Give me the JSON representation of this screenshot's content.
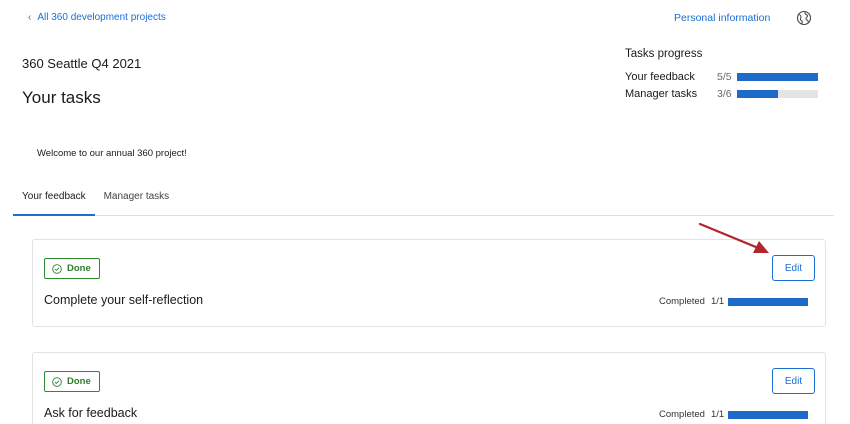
{
  "header": {
    "back_link": "All 360 development projects",
    "personal_link": "Personal information",
    "globe_icon": "globe-icon"
  },
  "project": {
    "name": "360 Seattle Q4 2021",
    "page_title": "Your tasks"
  },
  "progress": {
    "title": "Tasks progress",
    "rows": [
      {
        "label": "Your feedback",
        "count": "5/5",
        "fraction": 1.0
      },
      {
        "label": "Manager tasks",
        "count": "3/6",
        "fraction": 0.5
      }
    ]
  },
  "welcome": "Welcome to our annual 360 project!",
  "tabs": [
    {
      "label": "Your feedback",
      "active": true
    },
    {
      "label": "Manager tasks",
      "active": false
    }
  ],
  "tasks": [
    {
      "status": "Done",
      "title": "Complete your self-reflection",
      "edit_label": "Edit",
      "completed_label": "Completed",
      "completed_count": "1/1",
      "fraction": 1.0
    },
    {
      "status": "Done",
      "title": "Ask for feedback",
      "edit_label": "Edit",
      "completed_label": "Completed",
      "completed_count": "1/1",
      "fraction": 1.0
    }
  ],
  "colors": {
    "accent": "#1a6fd4",
    "bar_fill": "#1e6ac8",
    "done_green": "#2f7d2f",
    "annotation_arrow": "#b3262d"
  }
}
